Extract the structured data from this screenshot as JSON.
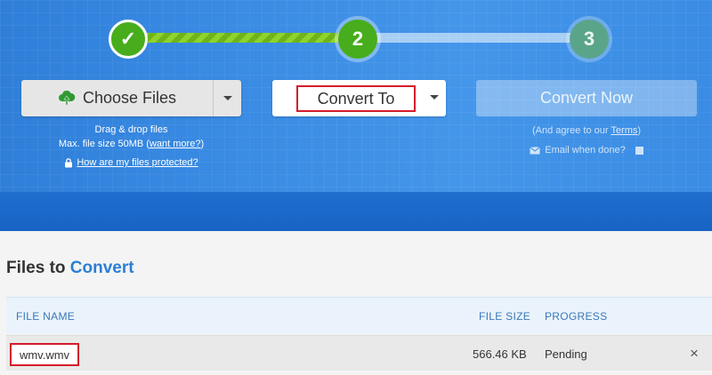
{
  "steps": [
    {
      "label": "✓",
      "state": "done"
    },
    {
      "label": "2",
      "state": "active"
    },
    {
      "label": "3",
      "state": "pending"
    }
  ],
  "colors": {
    "accent": "#2b7fd4",
    "hero_blue": "#3a8ce4",
    "step_green": "#47ad1c",
    "highlight_red": "#d51b2b"
  },
  "upload": {
    "choose_label": "Choose Files",
    "icon": "cloud-upload-icon",
    "hint_drag": "Drag & drop files",
    "hint_max_prefix": "Max. file size 50MB (",
    "hint_max_link": "want more?",
    "hint_max_suffix": ")",
    "protected_link": "How are my files protected?",
    "protected_icon": "lock-icon"
  },
  "convert_to": {
    "label": "Convert To"
  },
  "convert_now": {
    "label": "Convert Now",
    "agree_prefix": "(And agree to our ",
    "agree_link": "Terms",
    "agree_suffix": ")",
    "email_label": "Email when done?",
    "email_icon": "envelope-icon"
  },
  "files": {
    "title_prefix": "Files to ",
    "title_accent": "Convert",
    "columns": {
      "name": "FILE NAME",
      "size": "FILE SIZE",
      "progress": "PROGRESS"
    },
    "rows": [
      {
        "name": "wmv.wmv",
        "size": "566.46 KB",
        "status": "Pending",
        "remove": "×"
      }
    ]
  }
}
